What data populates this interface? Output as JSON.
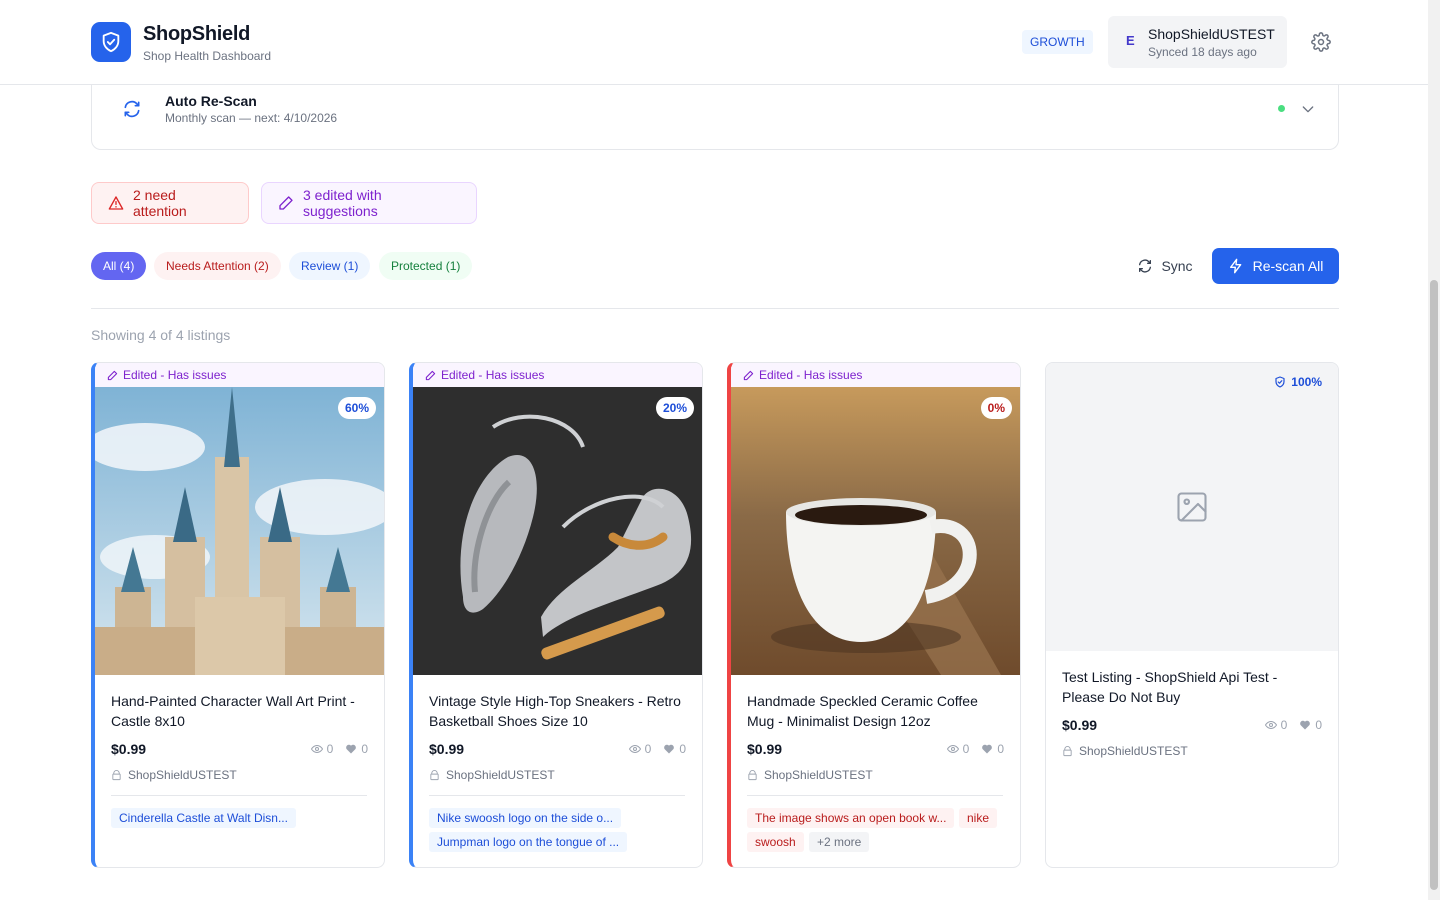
{
  "header": {
    "brand_title": "ShopShield",
    "brand_subtitle": "Shop Health Dashboard",
    "plan_badge": "GROWTH",
    "shop_initial": "E",
    "shop_name": "ShopShieldUSTEST",
    "shop_sync": "Synced 18 days ago"
  },
  "rescan": {
    "title": "Auto Re-Scan",
    "subtitle": "Monthly scan — next: 4/10/2026"
  },
  "alerts": {
    "attention": "2 need attention",
    "edited": "3 edited with suggestions"
  },
  "filters": {
    "all": "All (4)",
    "needs_attention": "Needs Attention (2)",
    "review": "Review (1)",
    "protected": "Protected (1)"
  },
  "actions": {
    "sync": "Sync",
    "rescan_all": "Re-scan All"
  },
  "showing": "Showing 4 of 4 listings",
  "cards": [
    {
      "banner": "Edited - Has issues",
      "score": "60%",
      "title": "Hand-Painted Character Wall Art Print - Castle 8x10",
      "price": "$0.99",
      "views": "0",
      "likes": "0",
      "shop": "ShopShieldUSTEST",
      "tags": [
        "Cinderella Castle at Walt Disn..."
      ]
    },
    {
      "banner": "Edited - Has issues",
      "score": "20%",
      "title": "Vintage Style High-Top Sneakers - Retro Basketball Shoes Size 10",
      "price": "$0.99",
      "views": "0",
      "likes": "0",
      "shop": "ShopShieldUSTEST",
      "tags": [
        "Nike swoosh logo on the side o...",
        "Jumpman logo on the tongue of ..."
      ]
    },
    {
      "banner": "Edited - Has issues",
      "score": "0%",
      "title": "Handmade Speckled Ceramic Coffee Mug - Minimalist Design 12oz",
      "price": "$0.99",
      "views": "0",
      "likes": "0",
      "shop": "ShopShieldUSTEST",
      "tags": [
        "The image shows an open book w...",
        "nike",
        "swoosh",
        "+2 more"
      ]
    },
    {
      "score": "100%",
      "title": "Test Listing - ShopShield Api Test - Please Do Not Buy",
      "price": "$0.99",
      "views": "0",
      "likes": "0",
      "shop": "ShopShieldUSTEST"
    }
  ],
  "colors": {
    "primary": "#2563eb",
    "attention": "#b91c1c",
    "edited": "#7e22ce",
    "protected": "#15803d",
    "filter_active": "#6366f1"
  }
}
